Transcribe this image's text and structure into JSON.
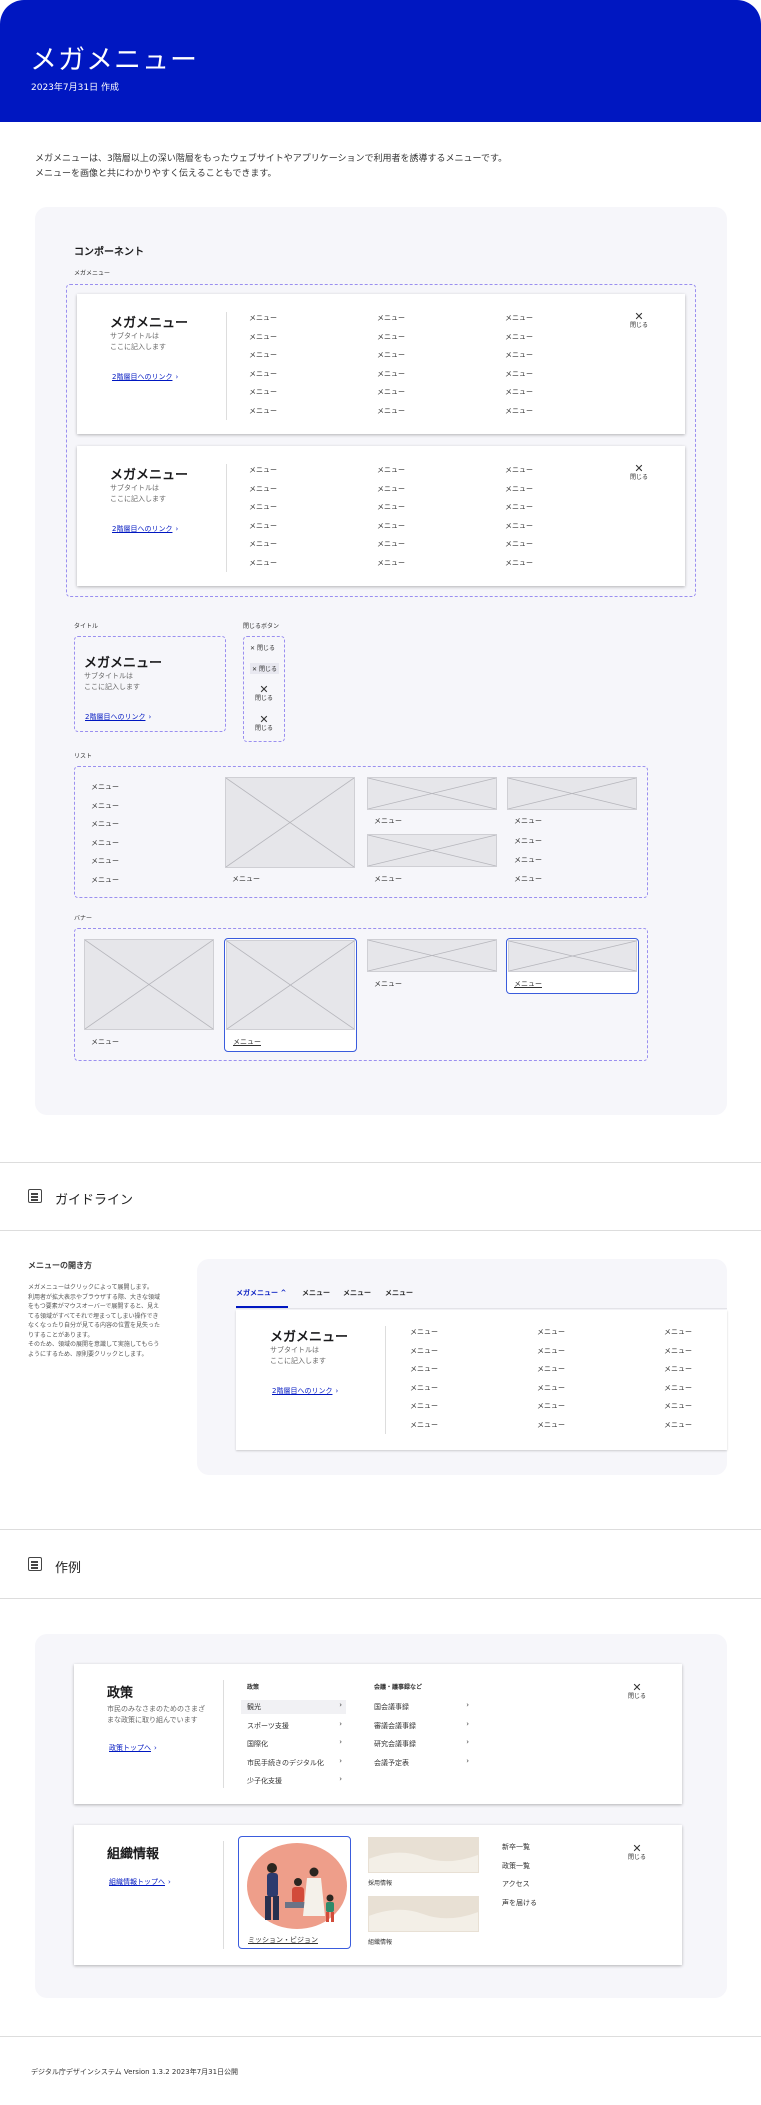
{
  "header": {
    "title": "メガメニュー",
    "date": "2023年7月31日 作成"
  },
  "intro": {
    "line1": "メガメニューは、3階層以上の深い階層をもったウェブサイトやアプリケーションで利用者を誘導するメニューです。",
    "line2": "メニューを画像と共にわかりやすく伝えることもできます。"
  },
  "component": {
    "heading": "コンポーネント",
    "label_megamenu": "メガメニュー",
    "label_title": "タイトル",
    "label_close": "閉じるボタン",
    "label_list": "リスト",
    "label_banner": "バナー",
    "menu_title": "メガメニュー",
    "subtitle_l1": "サブタイトルは",
    "subtitle_l2": "ここに記入します",
    "link": "2階層目へのリンク",
    "item": "メニュー",
    "close": "閉じる"
  },
  "guideline": {
    "section_title": "ガイドライン",
    "heading": "メニューの開き方",
    "body": [
      "メガメニューはクリックによって展開します。",
      "利用者が拡大表示やブラウザする際、大きな領域",
      "をもつ要素がマウスオーバーで展開すると、見え",
      "てる領域がすべてそれで埋まってしまい操作でき",
      "なくなったり自分が見てる内容の位置を見失った",
      "りすることがあります。",
      "そのため、領域の展開を意識して実施してもらう",
      "ようにするため、原則要クリックとします。"
    ],
    "tabs": [
      "メガメニュー",
      "メニュー",
      "メニュー",
      "メニュー"
    ]
  },
  "examples": {
    "section_title": "作例",
    "policy": {
      "title": "政策",
      "desc_l1": "市民のみなさまのためのさまざ",
      "desc_l2": "まな政策に取り組んでいます",
      "link": "政策トップへ",
      "col1_head": "政策",
      "col1": [
        "観光",
        "スポーツ支援",
        "国際化",
        "市民手続きのデジタル化",
        "少子化支援"
      ],
      "col2_head": "会議・議事録など",
      "col2": [
        "国会議事録",
        "審議会議事録",
        "研究会議事録",
        "会議予定表"
      ],
      "close": "閉じる"
    },
    "org": {
      "title": "組織情報",
      "link": "組織情報トップへ",
      "banners": [
        "ミッション・ビジョン",
        "採用情報",
        "組織情報"
      ],
      "list": [
        "新卒一覧",
        "政策一覧",
        "アクセス",
        "声を届ける"
      ],
      "close": "閉じる"
    }
  },
  "footer": "デジタル庁デザインシステム Version 1.3.2 2023年7月31日公開",
  "colors": {
    "brand": "#0017c1"
  }
}
